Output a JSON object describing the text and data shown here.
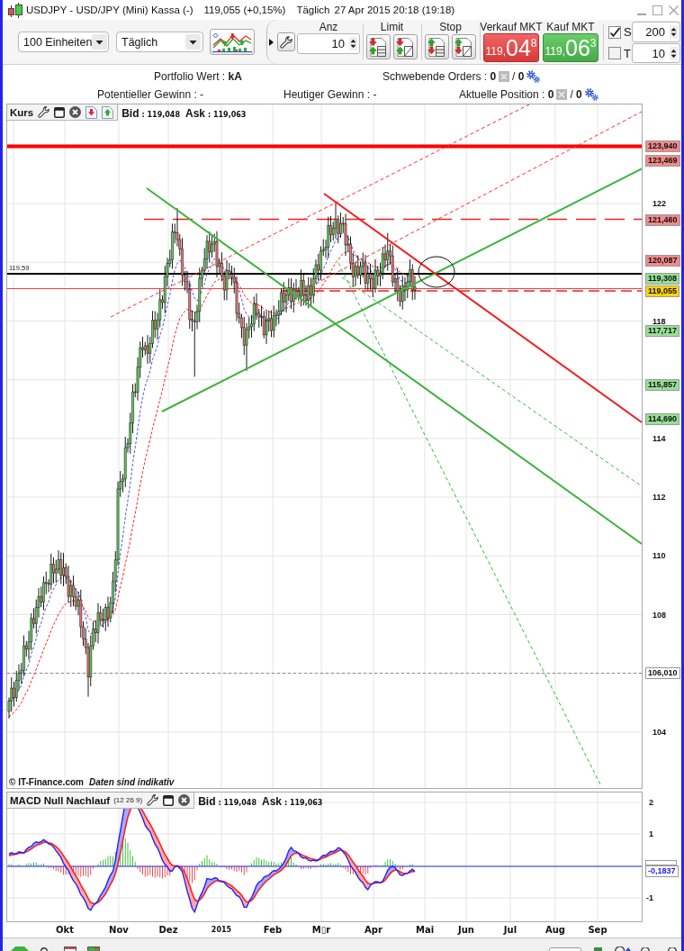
{
  "window": {
    "title": "USDJPY - USD/JPY (Mini) Kassa (-)",
    "quote": "119,055 (+0,15%)",
    "interval": "Täglich",
    "timestamp": "27 Apr 2015 20:18 (19:18)"
  },
  "toolbar": {
    "selects": [
      {
        "value": "100 Einheiten"
      },
      {
        "value": "Täglich"
      }
    ],
    "quantity": {
      "label": "Anz",
      "value": "10"
    },
    "order_groups": [
      {
        "label": "Limit",
        "kind": "limit"
      },
      {
        "label": "Stop",
        "kind": "stop"
      }
    ],
    "market_buttons": [
      {
        "label": "Verkauf MKT",
        "kind": "sell",
        "price_prefix": "119,",
        "price_main": "04",
        "price_suffix": "8"
      },
      {
        "label": "Kauf MKT",
        "kind": "buy",
        "price_prefix": "119,",
        "price_main": "06",
        "price_suffix": "3"
      }
    ],
    "options": [
      {
        "label": "S",
        "checked": true,
        "value": "200"
      },
      {
        "label": "T",
        "checked": false,
        "value": "10"
      }
    ]
  },
  "info_rows": [
    [
      {
        "text": "Portfolio Wert : **kA**"
      },
      {
        "text": "Schwebende Orders : **0**",
        "text_2": "/ **0**"
      }
    ],
    [
      {
        "text": "Potentieller Gewinn : -"
      },
      {
        "text": "Heutiger Gewinn : -"
      },
      {
        "text": "Aktuelle Position : **0**",
        "text_2": "/ **0**"
      }
    ]
  ],
  "price_chart": {
    "title": "Kurs",
    "quotes": [
      {
        "label": "Bid",
        "value": ": 119,048"
      },
      {
        "label": "Ask",
        "value": ": 119,063"
      }
    ],
    "level_label": "119,59",
    "price_ticks": [
      "122",
      "118",
      "114",
      "112",
      "110",
      "108",
      "104"
    ],
    "price_tags": [
      {
        "text": "123,940",
        "color": "#f28a8a"
      },
      {
        "text": "123,469",
        "color": "#f28a8a"
      },
      {
        "text": "121,460",
        "color": "#f28a8a"
      },
      {
        "text": "120,087",
        "color": "#f28a8a"
      },
      {
        "text": "119,308",
        "color": "#96e096"
      },
      {
        "text": "119,055",
        "color": "#ffd400"
      },
      {
        "text": "117,717",
        "color": "#96e096"
      },
      {
        "text": "115,857",
        "color": "#96e096"
      },
      {
        "text": "114,690",
        "color": "#96e096"
      },
      {
        "text": "106,010",
        "color": "#ffffff"
      }
    ],
    "source": "© IT-Finance.com",
    "note": "Daten sind indikativ"
  },
  "macd_chart": {
    "title": "MACD Null Nachlauf",
    "params": "(12 26 9)",
    "quotes": [
      {
        "label": "Bid",
        "value": ": 119,048"
      },
      {
        "label": "Ask",
        "value": ": 119,063"
      }
    ],
    "ticks": [
      "2",
      "1",
      "-1"
    ],
    "value_tag": "-0,1837"
  },
  "time_axis": [
    {
      "text": "Okt",
      "kind": "month"
    },
    {
      "text": "Nov",
      "kind": "month"
    },
    {
      "text": "Dez",
      "kind": "month"
    },
    {
      "text": "2015",
      "kind": "year"
    },
    {
      "text": "Feb",
      "kind": "month"
    },
    {
      "text": "M▯r",
      "kind": "month"
    },
    {
      "text": "Apr",
      "kind": "month"
    },
    {
      "text": "Mai",
      "kind": "month"
    },
    {
      "text": "Jun",
      "kind": "month"
    },
    {
      "text": "Jul",
      "kind": "month"
    },
    {
      "text": "Aug",
      "kind": "month"
    },
    {
      "text": "Sep",
      "kind": "month"
    }
  ]
}
